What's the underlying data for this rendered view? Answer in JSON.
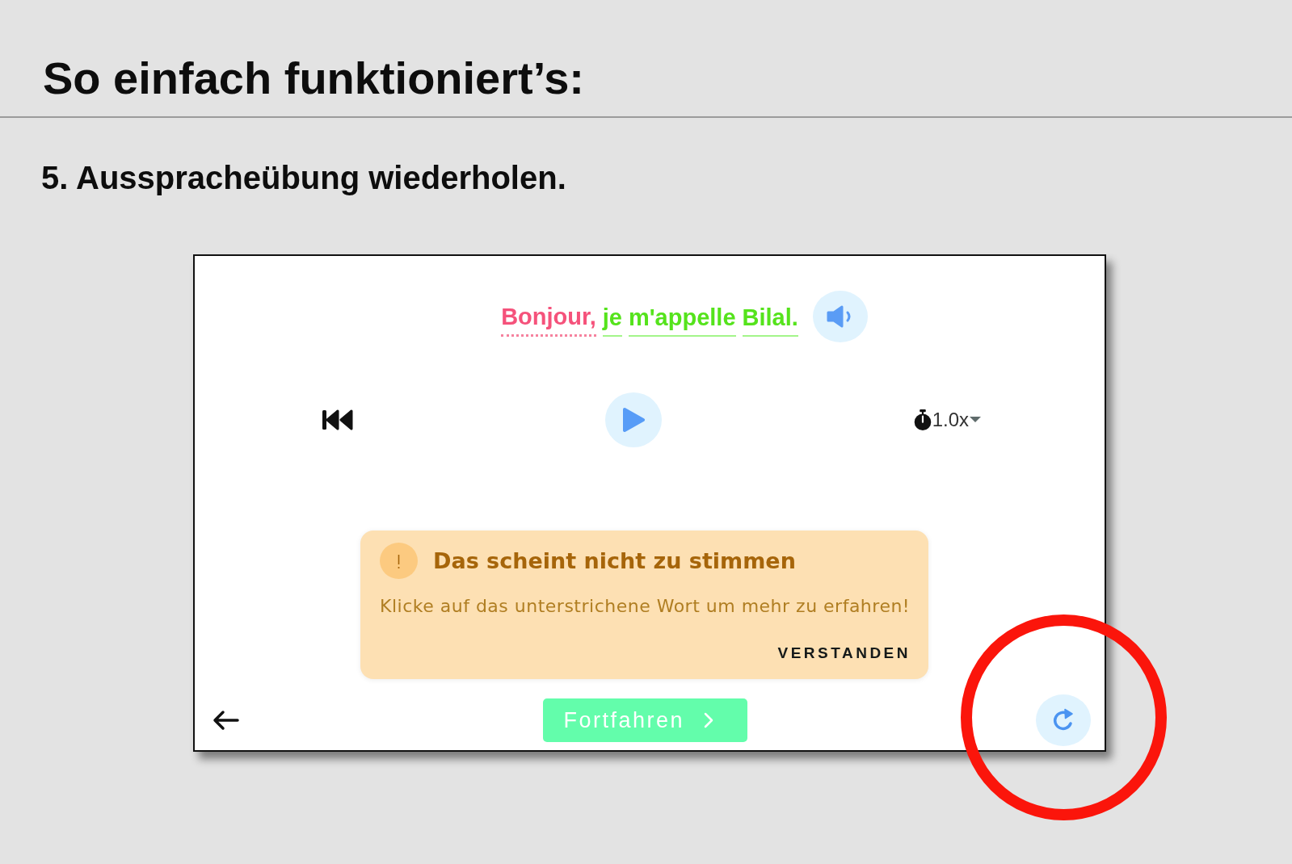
{
  "heading": "So einfach funktioniert’s:",
  "step": "5. Ausspracheübung wiederholen.",
  "exercise": {
    "sentence": [
      {
        "text": "Bonjour,",
        "correct": false
      },
      {
        "text": "je",
        "correct": true
      },
      {
        "text": "m'appelle",
        "correct": true
      },
      {
        "text": "Bilal.",
        "correct": true
      }
    ],
    "speed": "1.0x",
    "alert": {
      "title": "Das scheint nicht zu stimmen",
      "message": "Klicke auf das unterstrichene Wort um mehr zu erfahren!",
      "action": "VERSTANDEN"
    },
    "continue_button": "Fortfahren",
    "retry_button": {
      "circled": true
    }
  }
}
